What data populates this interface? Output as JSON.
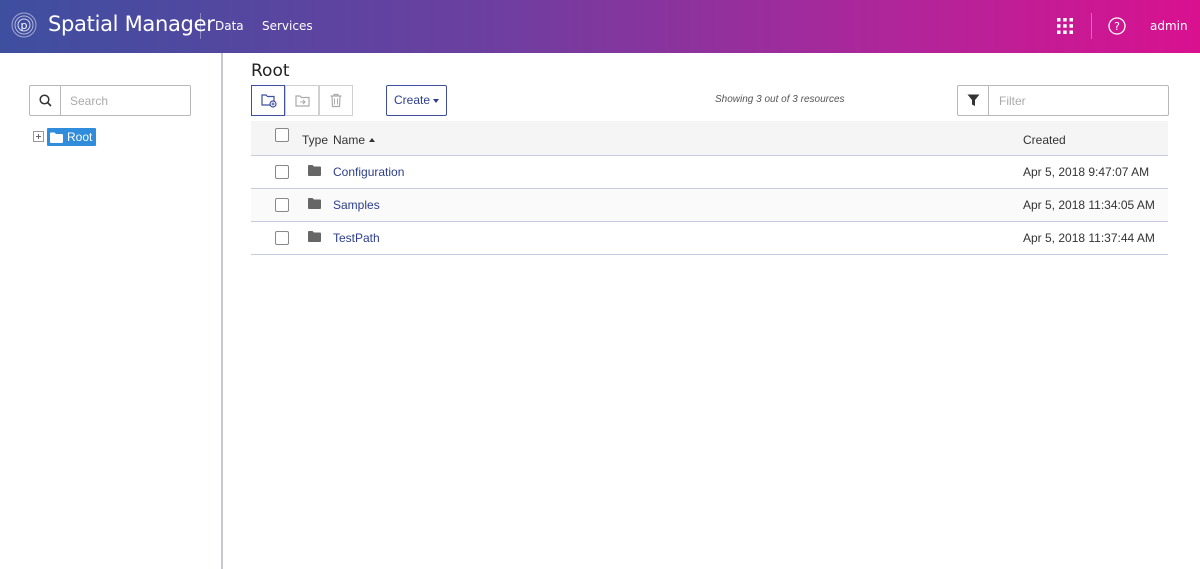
{
  "header": {
    "app_title": "Spatial Manager",
    "nav": [
      "Data",
      "Services"
    ],
    "user": "admin",
    "icons": [
      "logo-icon",
      "apps-grid-icon",
      "help-icon"
    ]
  },
  "sidebar": {
    "search_placeholder": "Search",
    "tree": {
      "label": "Root",
      "expanded": false,
      "selected": true
    }
  },
  "main": {
    "title": "Root",
    "toolbar": {
      "create_label": "Create",
      "showing": "Showing 3 out of 3 resources",
      "filter_placeholder": "Filter"
    },
    "table": {
      "headers": {
        "type": "Type",
        "name": "Name",
        "created": "Created"
      },
      "sort": {
        "column": "name",
        "direction": "asc"
      },
      "rows": [
        {
          "name": "Configuration",
          "created": "Apr 5, 2018 9:47:07 AM"
        },
        {
          "name": "Samples",
          "created": "Apr 5, 2018 11:34:05 AM"
        },
        {
          "name": "TestPath",
          "created": "Apr 5, 2018 11:37:44 AM"
        }
      ]
    }
  },
  "colors": {
    "header_gradient_start": "#3e4fa0",
    "header_gradient_end": "#d9118f",
    "accent": "#3e4fa0",
    "link": "#2c3e8c",
    "tree_selected": "#2f8ddb"
  }
}
